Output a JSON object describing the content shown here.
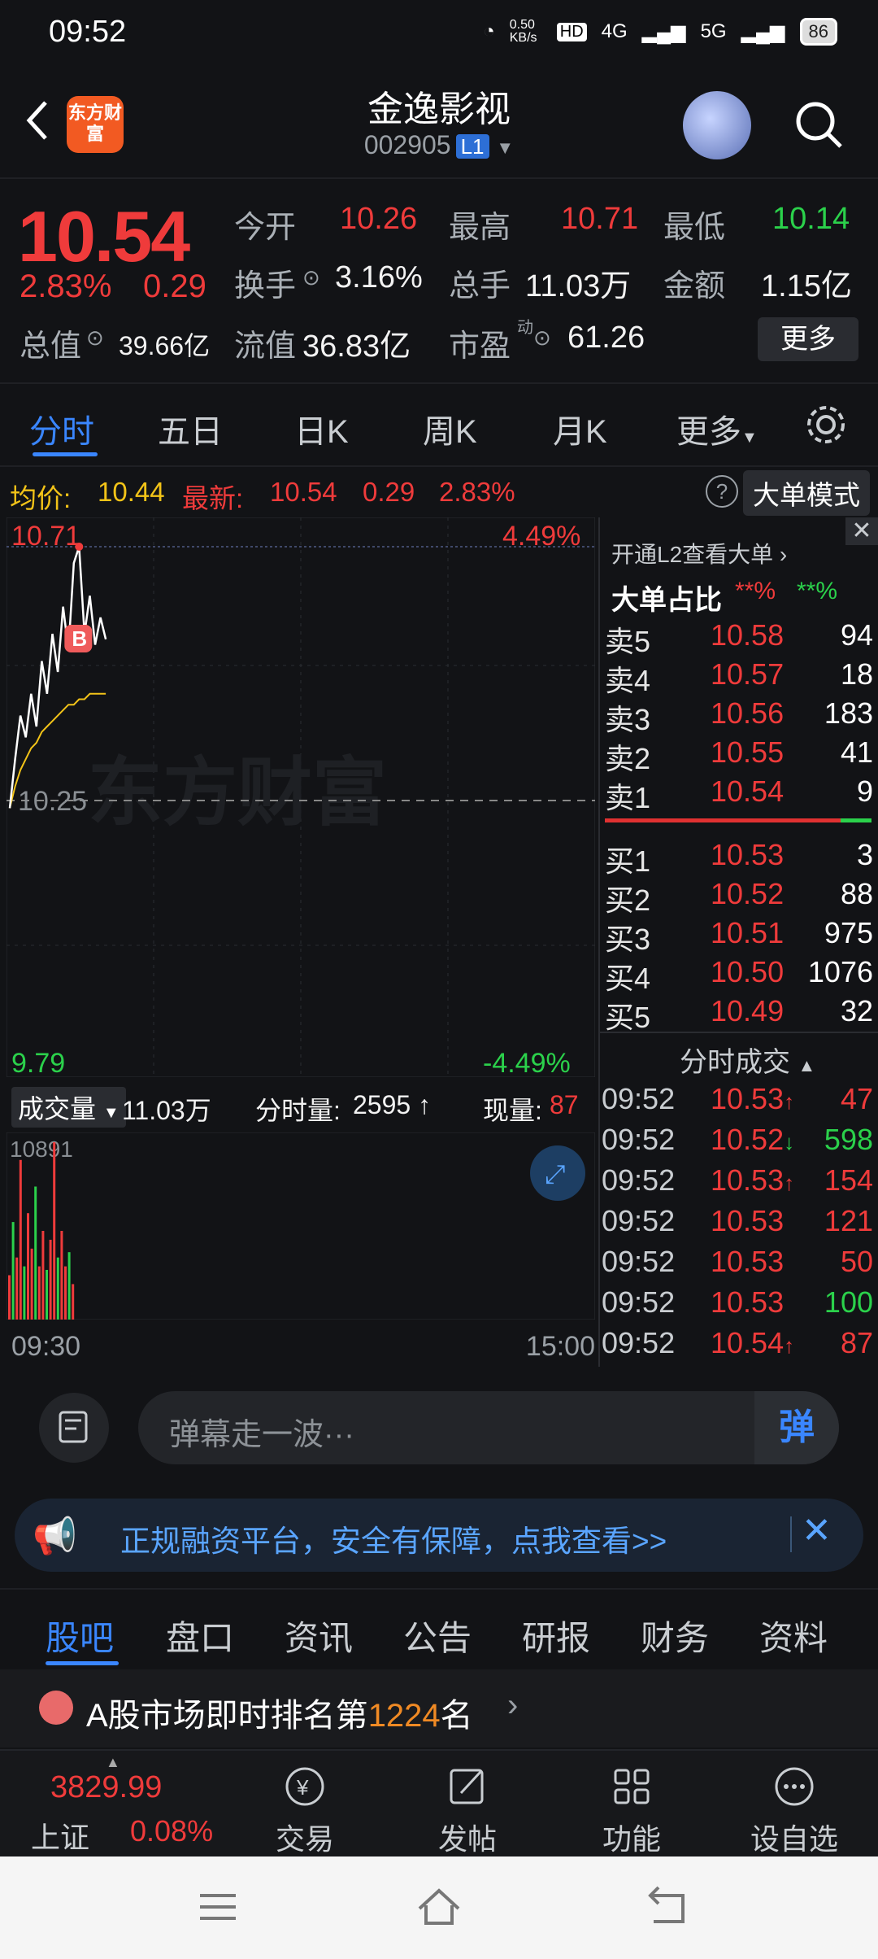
{
  "status": {
    "time": "09:52",
    "speed": "0.50 KB/s",
    "network1": "4G",
    "network2": "5G",
    "hd": "HD",
    "battery": "86"
  },
  "header": {
    "logo": "东方财富",
    "title": "金逸影视",
    "code": "002905",
    "level": "L1"
  },
  "quote": {
    "price": "10.54",
    "change_pct": "2.83%",
    "change_abs": "0.29",
    "open_label": "今开",
    "open": "10.26",
    "high_label": "最高",
    "high": "10.71",
    "low_label": "最低",
    "low": "10.14",
    "turnover_label": "换手",
    "turnover": "3.16%",
    "volume_label": "总手",
    "volume": "11.03万",
    "amount_label": "金额",
    "amount": "1.15亿",
    "mcap_label": "总值",
    "mcap": "39.66亿",
    "float_label": "流值",
    "float": "36.83亿",
    "pe_label": "市盈",
    "pe_sup": "动",
    "pe": "61.26",
    "more": "更多"
  },
  "tabs": [
    "分时",
    "五日",
    "日K",
    "周K",
    "月K",
    "更多"
  ],
  "chartinfo": {
    "avg_label": "均价:",
    "avg": "10.44",
    "latest_label": "最新:",
    "latest": "10.54",
    "latest_abs": "0.29",
    "latest_pct": "2.83%",
    "help": "?",
    "big_mode": "大单模式"
  },
  "chart_data": {
    "type": "line",
    "title": "",
    "price_max": "10.71",
    "price_mid": "10.25",
    "price_min": "9.79",
    "pct_max": "4.49%",
    "pct_min": "-4.49%",
    "ylim": [
      9.79,
      10.71
    ],
    "series": [
      {
        "values": [
          10.23,
          10.32,
          10.4,
          10.36,
          10.44,
          10.38,
          10.5,
          10.44,
          10.55,
          10.48,
          10.6,
          10.52,
          10.68,
          10.71,
          10.55,
          10.62,
          10.53,
          10.58,
          10.54
        ]
      },
      {
        "values": [
          10.23,
          10.27,
          10.3,
          10.32,
          10.34,
          10.35,
          10.37,
          10.38,
          10.39,
          10.4,
          10.41,
          10.42,
          10.42,
          10.43,
          10.43,
          10.44,
          10.44,
          10.44,
          10.44
        ]
      }
    ],
    "marker": "B",
    "watermark": "东方财富"
  },
  "orderbook": {
    "l2_link": "开通L2查看大单",
    "big_ratio_label": "大单占比",
    "big_buy": "**%",
    "big_sell": "**%",
    "asks": [
      {
        "label": "卖5",
        "price": "10.58",
        "vol": "94"
      },
      {
        "label": "卖4",
        "price": "10.57",
        "vol": "18"
      },
      {
        "label": "卖3",
        "price": "10.56",
        "vol": "183"
      },
      {
        "label": "卖2",
        "price": "10.55",
        "vol": "41"
      },
      {
        "label": "卖1",
        "price": "10.54",
        "vol": "9"
      }
    ],
    "bids": [
      {
        "label": "买1",
        "price": "10.53",
        "vol": "3"
      },
      {
        "label": "买2",
        "price": "10.52",
        "vol": "88"
      },
      {
        "label": "买3",
        "price": "10.51",
        "vol": "975"
      },
      {
        "label": "买4",
        "price": "10.50",
        "vol": "1076"
      },
      {
        "label": "买5",
        "price": "10.49",
        "vol": "32"
      }
    ],
    "ticks_label": "分时成交",
    "ticks": [
      {
        "time": "09:52",
        "price": "10.53",
        "dir": "↑",
        "vol": "47",
        "color": "#ef3b3b"
      },
      {
        "time": "09:52",
        "price": "10.52",
        "dir": "↓",
        "vol": "598",
        "color": "#2bd14b"
      },
      {
        "time": "09:52",
        "price": "10.53",
        "dir": "↑",
        "vol": "154",
        "color": "#ef3b3b"
      },
      {
        "time": "09:52",
        "price": "10.53",
        "dir": "",
        "vol": "121",
        "color": "#ef3b3b"
      },
      {
        "time": "09:52",
        "price": "10.53",
        "dir": "",
        "vol": "50",
        "color": "#ef3b3b"
      },
      {
        "time": "09:52",
        "price": "10.53",
        "dir": "",
        "vol": "100",
        "color": "#2bd14b"
      },
      {
        "time": "09:52",
        "price": "10.54",
        "dir": "↑",
        "vol": "87",
        "color": "#ef3b3b"
      }
    ]
  },
  "volume": {
    "label": "成交量",
    "total": "11.03万",
    "minute_label": "分时量:",
    "minute": "2595",
    "minute_arrow": "↑",
    "now_label": "现量:",
    "now": "87",
    "max": "10891",
    "bars": [
      0.25,
      0.55,
      0.35,
      0.9,
      0.3,
      0.6,
      0.4,
      0.75,
      0.3,
      0.5,
      0.28,
      0.45,
      1.0,
      0.35,
      0.5,
      0.3,
      0.38,
      0.2
    ],
    "start_time": "09:30",
    "end_time": "15:00"
  },
  "comment": {
    "placeholder": "弹幕走一波···",
    "dan": "弹"
  },
  "ad": {
    "text": "正规融资平台，安全有保障，点我查看>>"
  },
  "subtabs": [
    "股吧",
    "盘口",
    "资讯",
    "公告",
    "研报",
    "财务",
    "资料"
  ],
  "rank": {
    "prefix": "A股市场即时排名第",
    "num": "1224",
    "suffix": "名"
  },
  "bottomnav": {
    "index_value": "3829.99",
    "index_name": "上证",
    "index_pct": "0.08%",
    "items": [
      "交易",
      "发帖",
      "功能",
      "设自选"
    ]
  }
}
